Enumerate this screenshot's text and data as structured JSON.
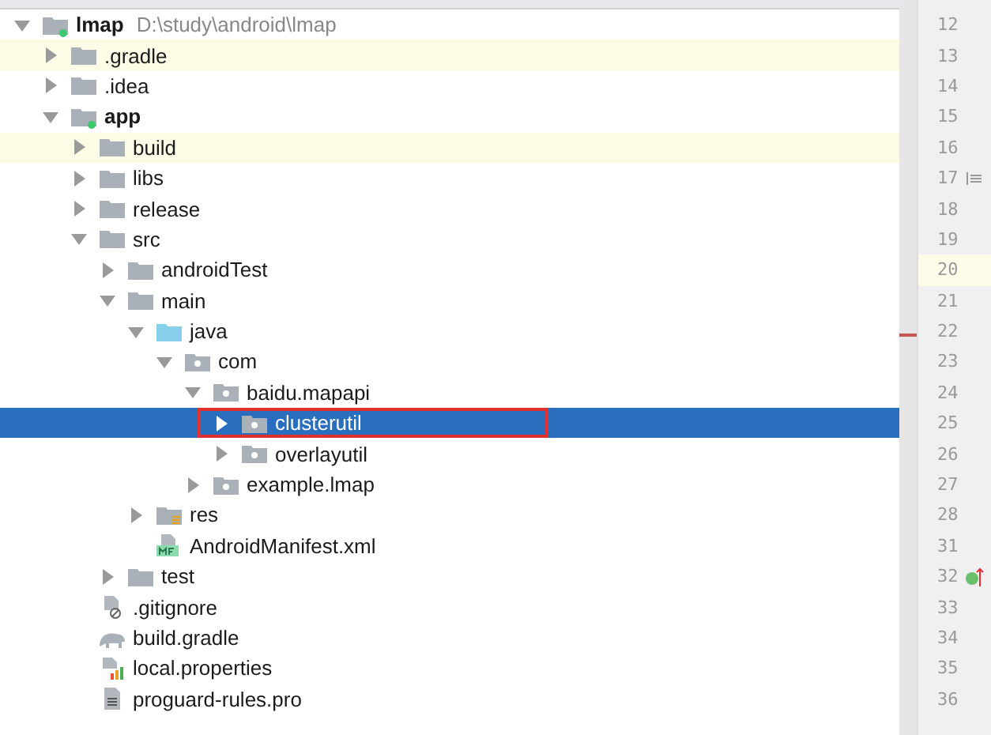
{
  "tree": [
    {
      "label": "lmap",
      "path": "D:\\study\\android\\lmap",
      "kind": "module",
      "expanded": true,
      "selected": false,
      "excluded": false,
      "children": [
        {
          "label": ".gradle",
          "kind": "folder",
          "expanded": false,
          "selected": false,
          "excluded": true
        },
        {
          "label": ".idea",
          "kind": "folder",
          "expanded": false,
          "selected": false,
          "excluded": false
        },
        {
          "label": "app",
          "kind": "module",
          "expanded": true,
          "selected": false,
          "excluded": false,
          "children": [
            {
              "label": "build",
              "kind": "folder",
              "expanded": false,
              "selected": false,
              "excluded": true
            },
            {
              "label": "libs",
              "kind": "folder",
              "expanded": false,
              "selected": false,
              "excluded": false
            },
            {
              "label": "release",
              "kind": "folder",
              "expanded": false,
              "selected": false,
              "excluded": false
            },
            {
              "label": "src",
              "kind": "folder",
              "expanded": true,
              "selected": false,
              "excluded": false,
              "children": [
                {
                  "label": "androidTest",
                  "kind": "folder",
                  "expanded": false,
                  "selected": false,
                  "excluded": false
                },
                {
                  "label": "main",
                  "kind": "folder",
                  "expanded": true,
                  "selected": false,
                  "excluded": false,
                  "children": [
                    {
                      "label": "java",
                      "kind": "source",
                      "expanded": true,
                      "selected": false,
                      "excluded": false,
                      "children": [
                        {
                          "label": "com",
                          "kind": "package",
                          "expanded": true,
                          "selected": false,
                          "excluded": false,
                          "children": [
                            {
                              "label": "baidu.mapapi",
                              "kind": "package",
                              "expanded": true,
                              "selected": false,
                              "excluded": false,
                              "children": [
                                {
                                  "label": "clusterutil",
                                  "kind": "package",
                                  "expanded": false,
                                  "selected": true,
                                  "excluded": false,
                                  "outlined": true
                                },
                                {
                                  "label": "overlayutil",
                                  "kind": "package",
                                  "expanded": false,
                                  "selected": false,
                                  "excluded": false
                                }
                              ]
                            },
                            {
                              "label": "example.lmap",
                              "kind": "package",
                              "expanded": false,
                              "selected": false,
                              "excluded": false
                            }
                          ]
                        }
                      ]
                    },
                    {
                      "label": "res",
                      "kind": "resources",
                      "expanded": false,
                      "selected": false,
                      "excluded": false
                    },
                    {
                      "label": "AndroidManifest.xml",
                      "kind": "manifest",
                      "selected": false,
                      "excluded": false
                    }
                  ]
                },
                {
                  "label": "test",
                  "kind": "folder",
                  "expanded": false,
                  "selected": false,
                  "excluded": false
                }
              ]
            },
            {
              "label": ".gitignore",
              "kind": "ignore",
              "selected": false,
              "excluded": false
            },
            {
              "label": "build.gradle",
              "kind": "gradle",
              "selected": false,
              "excluded": false
            },
            {
              "label": "local.properties",
              "kind": "properties",
              "selected": false,
              "excluded": false
            },
            {
              "label": "proguard-rules.pro",
              "kind": "text",
              "selected": false,
              "excluded": false
            }
          ]
        }
      ]
    }
  ],
  "gutter": [
    {
      "number": "12",
      "current": false,
      "kind": "plain"
    },
    {
      "number": "13",
      "current": false,
      "kind": "plain"
    },
    {
      "number": "14",
      "current": false,
      "kind": "plain"
    },
    {
      "number": "15",
      "current": false,
      "kind": "plain"
    },
    {
      "number": "16",
      "current": false,
      "kind": "plain"
    },
    {
      "number": "17",
      "current": false,
      "kind": "fold"
    },
    {
      "number": "18",
      "current": false,
      "kind": "plain"
    },
    {
      "number": "19",
      "current": false,
      "kind": "plain"
    },
    {
      "number": "20",
      "current": true,
      "kind": "plain"
    },
    {
      "number": "21",
      "current": false,
      "kind": "plain"
    },
    {
      "number": "22",
      "current": false,
      "kind": "plain"
    },
    {
      "number": "23",
      "current": false,
      "kind": "plain"
    },
    {
      "number": "24",
      "current": false,
      "kind": "plain"
    },
    {
      "number": "25",
      "current": false,
      "kind": "plain"
    },
    {
      "number": "26",
      "current": false,
      "kind": "plain"
    },
    {
      "number": "27",
      "current": false,
      "kind": "plain"
    },
    {
      "number": "28",
      "current": false,
      "kind": "plain"
    },
    {
      "number": "31",
      "current": false,
      "kind": "plain"
    },
    {
      "number": "32",
      "current": false,
      "kind": "implements"
    },
    {
      "number": "33",
      "current": false,
      "kind": "plain"
    },
    {
      "number": "34",
      "current": false,
      "kind": "plain"
    },
    {
      "number": "35",
      "current": false,
      "kind": "plain"
    },
    {
      "number": "36",
      "current": false,
      "kind": "plain"
    }
  ]
}
